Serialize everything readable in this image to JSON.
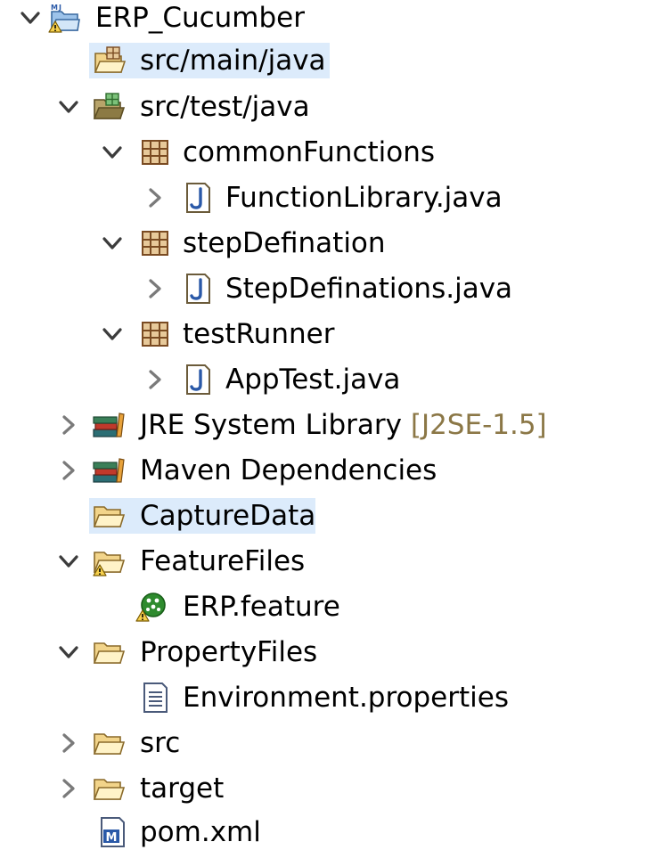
{
  "tree": {
    "project": {
      "label": "ERP_Cucumber",
      "icon": "maven-project-warning-icon"
    },
    "src_main_java": {
      "label": "src/main/java",
      "icon": "source-folder-icon"
    },
    "src_test_java": {
      "label": "src/test/java",
      "icon": "test-source-folder-icon"
    },
    "pkg_common": {
      "label": "commonFunctions",
      "icon": "package-icon"
    },
    "file_functionlib": {
      "label": "FunctionLibrary.java",
      "icon": "java-file-icon"
    },
    "pkg_step": {
      "label": "stepDefination",
      "icon": "package-icon"
    },
    "file_stepdefs": {
      "label": "StepDefinations.java",
      "icon": "java-file-icon"
    },
    "pkg_runner": {
      "label": "testRunner",
      "icon": "package-icon"
    },
    "file_apptest": {
      "label": "AppTest.java",
      "icon": "java-file-icon"
    },
    "jre": {
      "label": "JRE System Library",
      "decoration": "[J2SE-1.5]",
      "icon": "library-icon"
    },
    "maven_deps": {
      "label": "Maven Dependencies",
      "icon": "library-icon"
    },
    "capture": {
      "label": "CaptureData",
      "icon": "folder-icon"
    },
    "feature_files": {
      "label": "FeatureFiles",
      "icon": "folder-warning-icon"
    },
    "erp_feature": {
      "label": "ERP.feature",
      "icon": "cucumber-feature-warning-icon"
    },
    "property_files": {
      "label": "PropertyFiles",
      "icon": "folder-icon"
    },
    "env_props": {
      "label": "Environment.properties",
      "icon": "properties-file-icon"
    },
    "src": {
      "label": "src",
      "icon": "folder-icon"
    },
    "target": {
      "label": "target",
      "icon": "folder-icon"
    },
    "pom": {
      "label": "pom.xml",
      "icon": "maven-pom-icon"
    }
  },
  "colors": {
    "selection": "#dcebfb",
    "decoration_text": "#8b7746",
    "chevron": "#3c3c3c"
  }
}
